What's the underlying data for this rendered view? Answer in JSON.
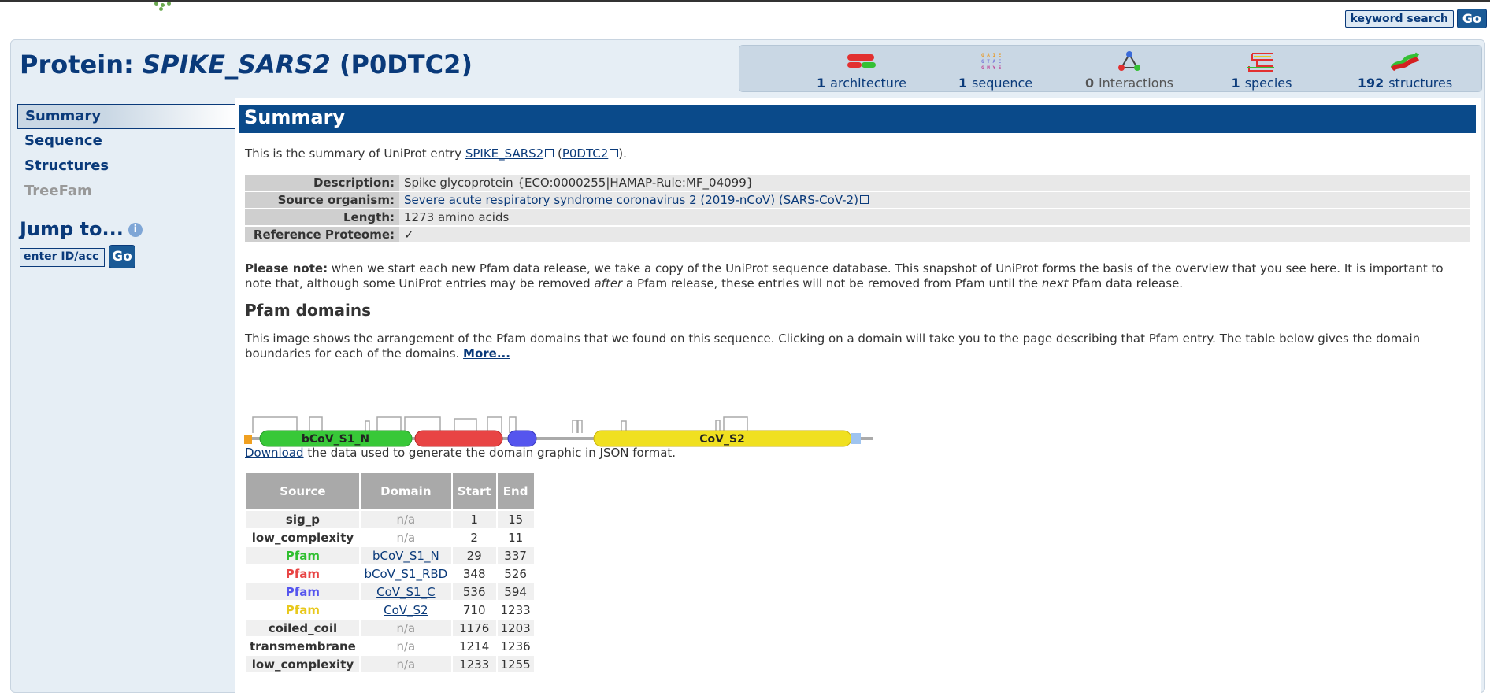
{
  "header": {
    "keyword_search_label": "keyword search",
    "go_label": "Go"
  },
  "title": {
    "prefix": "Protein:",
    "name": "SPIKE_SARS2",
    "accession": "(P0DTC2)"
  },
  "iconbar": [
    {
      "count": "1",
      "label": "architecture",
      "icon": "architecture-icon"
    },
    {
      "count": "1",
      "label": "sequence",
      "icon": "sequence-icon"
    },
    {
      "count": "0",
      "label": "interactions",
      "icon": "interactions-icon"
    },
    {
      "count": "1",
      "label": "species",
      "icon": "species-icon"
    },
    {
      "count": "192",
      "label": "structures",
      "icon": "structures-icon"
    }
  ],
  "sidebar": {
    "items": [
      {
        "label": "Summary",
        "state": "active"
      },
      {
        "label": "Sequence",
        "state": "normal"
      },
      {
        "label": "Structures",
        "state": "normal"
      },
      {
        "label": "TreeFam",
        "state": "disabled"
      }
    ],
    "jump_label": "Jump to...",
    "jump_placeholder": "enter ID/acc",
    "jump_go": "Go"
  },
  "summary": {
    "heading": "Summary",
    "intro_before": "This is the summary of UniProt entry ",
    "intro_link1": "SPIKE_SARS2",
    "intro_mid": " (",
    "intro_link2": "P0DTC2",
    "intro_after": ").",
    "props": [
      {
        "label": "Description:",
        "value": "Spike glycoprotein {ECO:0000255|HAMAP-Rule:MF_04099}",
        "link": false
      },
      {
        "label": "Source organism:",
        "value": "Severe acute respiratory syndrome coronavirus 2 (2019-nCoV) (SARS-CoV-2)",
        "link": true
      },
      {
        "label": "Length:",
        "value": "1273 amino acids",
        "link": false
      },
      {
        "label": "Reference Proteome:",
        "value": "✓",
        "link": false
      }
    ],
    "note_bold": "Please note:",
    "note_1": " when we start each new Pfam data release, we take a copy of the UniProt sequence database. This snapshot of UniProt forms the basis of the overview that you see here. It is important to note that, although some UniProt entries may be removed ",
    "note_em1": "after",
    "note_2": " a Pfam release, these entries will not be removed from Pfam until the ",
    "note_em2": "next",
    "note_3": " Pfam data release.",
    "pfam_heading": "Pfam domains",
    "pfam_desc": "This image shows the arrangement of the Pfam domains that we found on this sequence. Clicking on a domain will take you to the page describing that Pfam entry. The table below gives the domain boundaries for each of the domains. ",
    "more_label": "More...",
    "graphic_labels": {
      "d1": "bCoV_S1_N",
      "d4": "CoV_S2"
    },
    "download_link": "Download",
    "download_rest": " the data used to generate the domain graphic in JSON format."
  },
  "domain_table": {
    "headers": [
      "Source",
      "Domain",
      "Start",
      "End"
    ],
    "rows": [
      {
        "source": "sig_p",
        "domain": "n/a",
        "start": "1",
        "end": "15",
        "color": "#333333"
      },
      {
        "source": "low_complexity",
        "domain": "n/a",
        "start": "2",
        "end": "11",
        "color": "#333333"
      },
      {
        "source": "Pfam",
        "domain": "bCoV_S1_N",
        "start": "29",
        "end": "337",
        "color": "#2fbf2f"
      },
      {
        "source": "Pfam",
        "domain": "bCoV_S1_RBD",
        "start": "348",
        "end": "526",
        "color": "#e84444"
      },
      {
        "source": "Pfam",
        "domain": "CoV_S1_C",
        "start": "536",
        "end": "594",
        "color": "#5555ee"
      },
      {
        "source": "Pfam",
        "domain": "CoV_S2",
        "start": "710",
        "end": "1233",
        "color": "#e8c81c"
      },
      {
        "source": "coiled_coil",
        "domain": "n/a",
        "start": "1176",
        "end": "1203",
        "color": "#333333"
      },
      {
        "source": "transmembrane",
        "domain": "n/a",
        "start": "1214",
        "end": "1236",
        "color": "#333333"
      },
      {
        "source": "low_complexity",
        "domain": "n/a",
        "start": "1233",
        "end": "1255",
        "color": "#333333"
      }
    ]
  }
}
